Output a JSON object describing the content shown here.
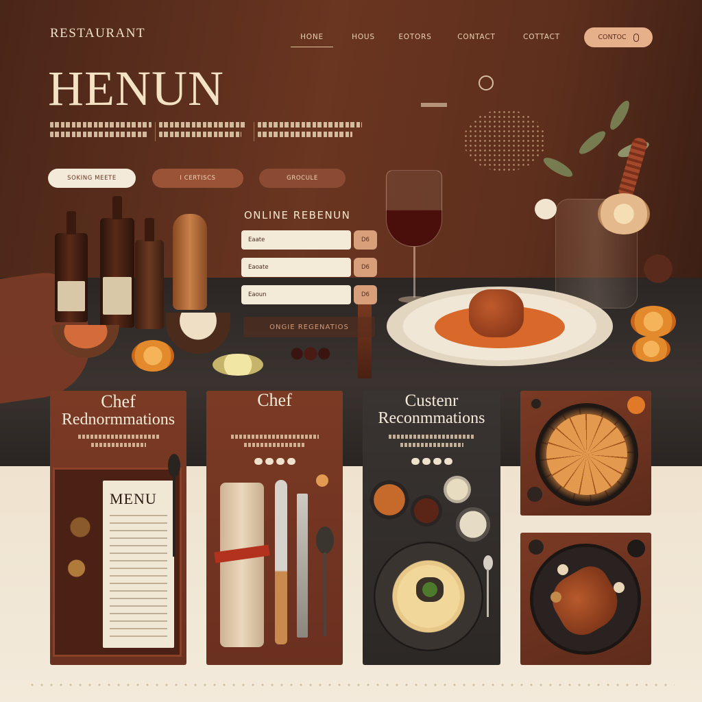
{
  "nav": {
    "brand": "RESTAURANT",
    "links": [
      "HONE",
      "HOUS",
      "EOTORS",
      "CONTACT",
      "COTTACT"
    ],
    "cta_label": "CONTOC"
  },
  "hero": {
    "title": "HENUN",
    "buttons": [
      "SOKING MEETE",
      "I CERTISCS",
      "GROCULE"
    ]
  },
  "reservation": {
    "title": "ONLINE REBENUN",
    "fields": [
      {
        "value": "Eaate",
        "button": "D6"
      },
      {
        "value": "Eaoate",
        "button": "D6"
      },
      {
        "value": "Eaoun",
        "button": "D6"
      }
    ],
    "submit_label": "ONGIE REGENATIOS"
  },
  "cards": [
    {
      "title_line1": "Chef",
      "title_line2": "Rednormmations",
      "menu_title": "MENU"
    },
    {
      "title_line1": "Chef"
    },
    {
      "title_line1": "Custenr",
      "title_line2": "Reconmmations"
    }
  ],
  "icons": {
    "nav_cta": "phone-icon",
    "wall": "circle-lamp-icon"
  },
  "colors": {
    "hero_bg": "#5e2f1d",
    "accent": "#e6b08a",
    "card_brown": "#7b3a24",
    "card_dark": "#393431",
    "cream": "#efe3cf"
  }
}
